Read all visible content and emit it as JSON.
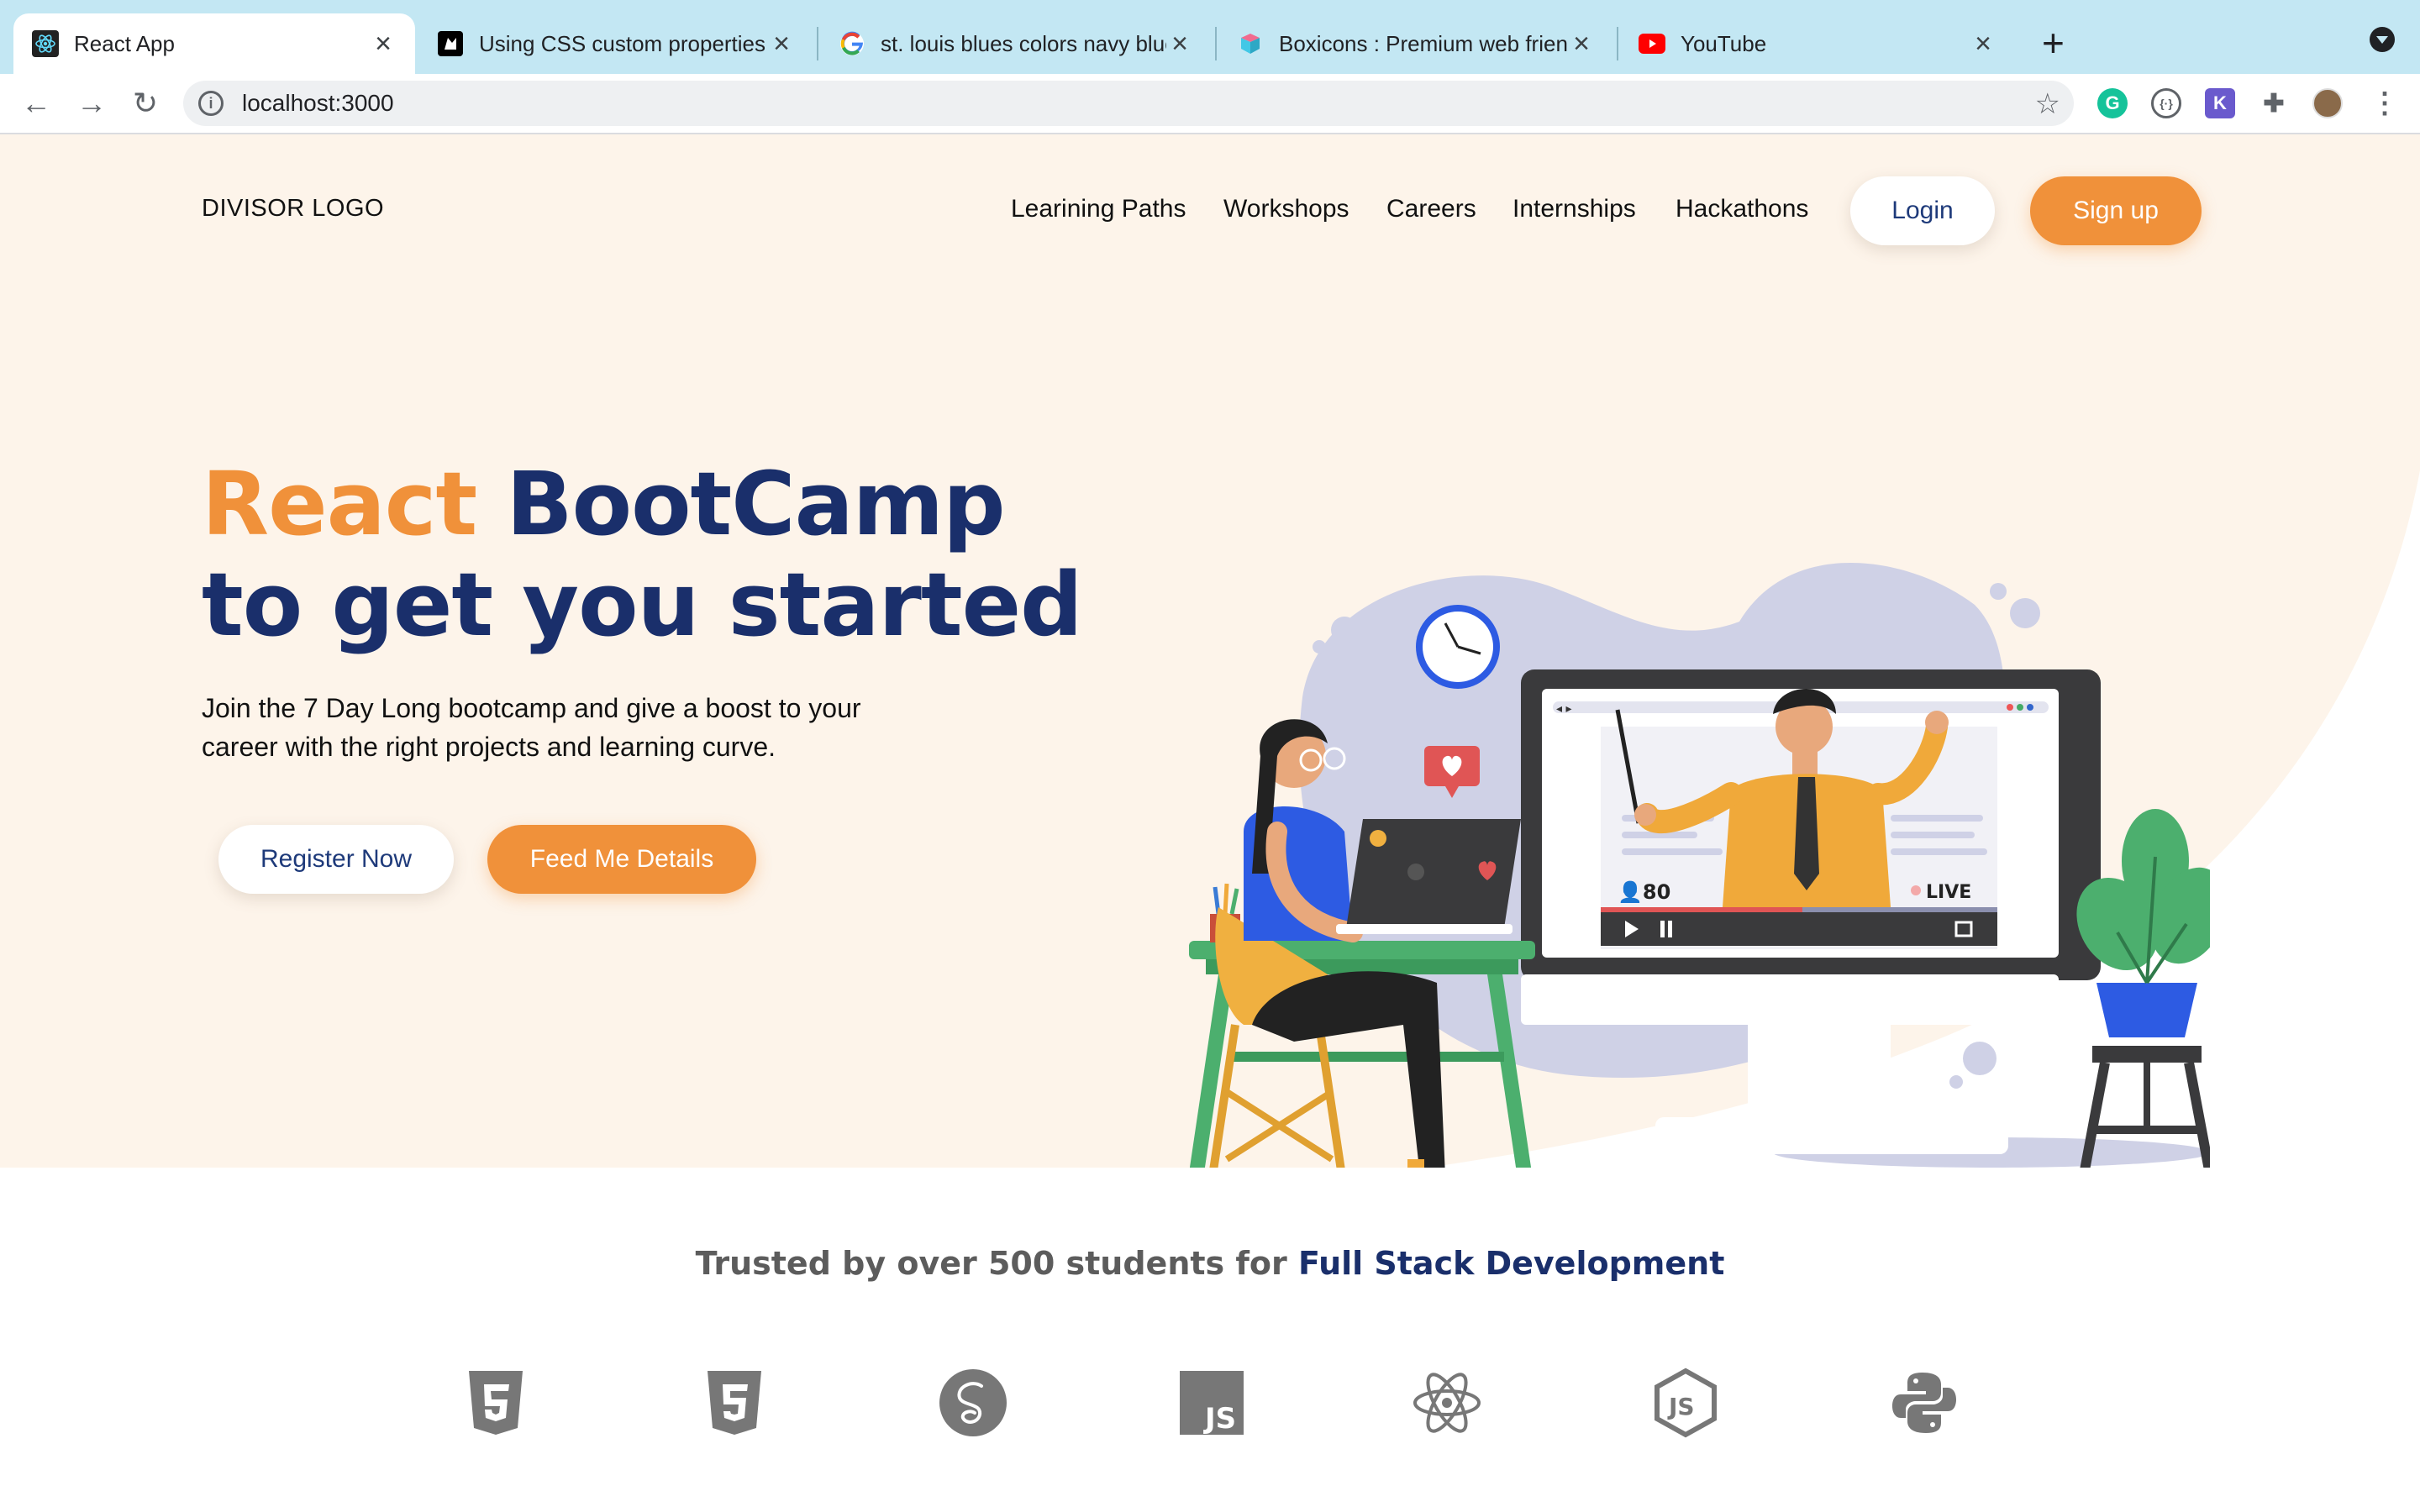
{
  "browser": {
    "tabs": [
      {
        "title": "React App",
        "icon": "react-icon",
        "active": true
      },
      {
        "title": "Using CSS custom properties (",
        "icon": "mdn-icon",
        "active": false
      },
      {
        "title": "st. louis blues colors navy blue",
        "icon": "google-icon",
        "active": false
      },
      {
        "title": "Boxicons : Premium web friend",
        "icon": "boxicons-icon",
        "active": false
      },
      {
        "title": "YouTube",
        "icon": "youtube-icon",
        "active": false
      }
    ],
    "url": "localhost:3000"
  },
  "header": {
    "logo": "DIVISOR LOGO",
    "nav": [
      "Learining Paths",
      "Workshops",
      "Careers",
      "Internships",
      "Hackathons"
    ],
    "login": "Login",
    "signup": "Sign up"
  },
  "hero": {
    "headline_accent": "React",
    "headline_rest": " BootCamp",
    "headline_line2": "to get you started",
    "subtext": "Join the 7 Day Long bootcamp and give a boost to your career with the right projects and learning curve.",
    "register": "Register Now",
    "feed": "Feed Me Details",
    "illustration": {
      "viewers": "80",
      "live": "LIVE"
    }
  },
  "trusted": {
    "prefix": "Trusted by over 500 students for ",
    "highlight": "Full Stack Development"
  },
  "technologies": [
    "html5-icon",
    "css3-icon",
    "sass-icon",
    "javascript-icon",
    "react-icon",
    "nodejs-icon",
    "python-icon"
  ],
  "colors": {
    "accent": "#f0913a",
    "navy": "#1a2f6b",
    "hero_bg": "#fdf4ea",
    "tabbar_bg": "#c3e7f3"
  }
}
